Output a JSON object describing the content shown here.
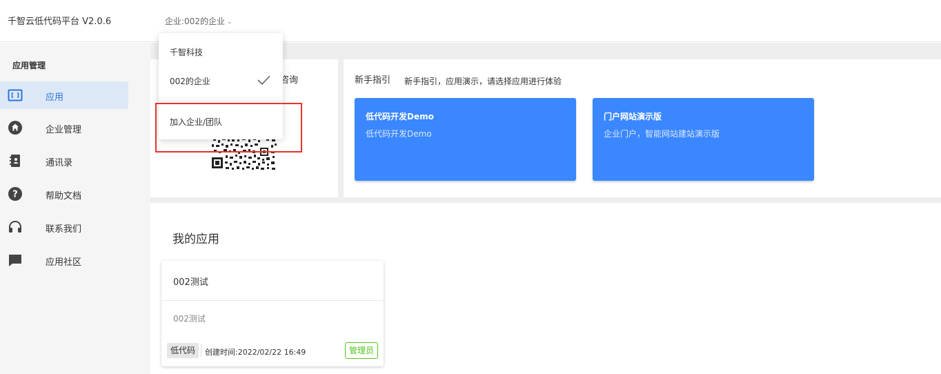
{
  "header": {
    "brand": "千智云低代码平台 V2.0.6",
    "org_switch": "企业:002的企业"
  },
  "org_dropdown": {
    "items": [
      {
        "label": "千智科技",
        "selected": false
      },
      {
        "label": "002的企业",
        "selected": true
      }
    ],
    "join_label": "加入企业/团队"
  },
  "sidebar": {
    "title": "应用管理",
    "items": [
      {
        "label": "应用",
        "icon": "app-icon",
        "active": true
      },
      {
        "label": "企业管理",
        "icon": "home-icon",
        "active": false
      },
      {
        "label": "通讯录",
        "icon": "contacts-book-icon",
        "active": false
      },
      {
        "label": "帮助文档",
        "icon": "help-icon",
        "active": false
      },
      {
        "label": "联系我们",
        "icon": "headset-icon",
        "active": false
      },
      {
        "label": "应用社区",
        "icon": "chat-bubble-icon",
        "active": false
      }
    ]
  },
  "consult": {
    "text_visible": "咨询"
  },
  "guide": {
    "title": "新手指引",
    "subtitle": "新手指引，应用演示，请选择应用进行体验",
    "demos": [
      {
        "title": "低代码开发Demo",
        "desc": "低代码开发Demo"
      },
      {
        "title": "门户网站演示版",
        "desc": "企业门户，智能网站建站演示版"
      }
    ]
  },
  "my_apps": {
    "title": "我的应用",
    "apps": [
      {
        "name": "002测试",
        "desc": "002测试",
        "type_tag": "低代码",
        "created": "创建时间:2022/02/22 16:49",
        "role": "管理员"
      }
    ]
  },
  "colors": {
    "accent": "#3a87ff",
    "active_nav_bg": "#dde8f7",
    "admin_green": "#52c41a",
    "highlight_red": "#e5322d"
  }
}
